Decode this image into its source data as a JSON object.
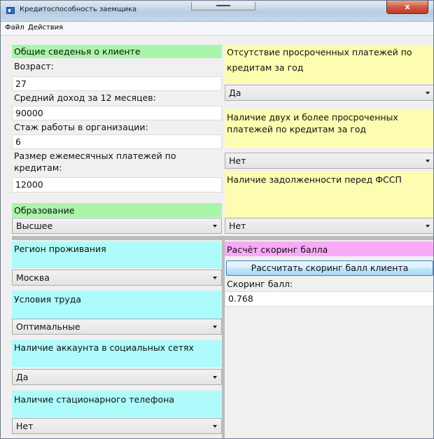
{
  "window": {
    "title": "Кредитоспособность заемщика",
    "close_label": "x"
  },
  "menu": {
    "items": [
      "Файл",
      "Действия"
    ]
  },
  "client": {
    "header": "Общие сведенья о клиенте",
    "age_label": "Возраст:",
    "age_value": "27",
    "income_label": "Средний доход за 12 месяцев:",
    "income_value": "90000",
    "experience_label": "Стаж работы в организации:",
    "experience_value": "6",
    "payments_label": "Размер ежемесячных платежей по кредитам:",
    "payments_value": "12000",
    "education_label": "Образование",
    "education_value": "Высшее"
  },
  "credit_history": {
    "no_overdue_label": "Отсутствие просроченных платежей по кредитам за год",
    "no_overdue_value": "Да",
    "two_overdue_label": "Наличие двух и более просроченных платежей по кредитам за год",
    "two_overdue_value": "Нет",
    "fssp_label": "Наличие задолженности перед ФССП",
    "fssp_value": "Нет"
  },
  "social": {
    "region_label": "Регион проживания",
    "region_value": "Москва",
    "conditions_label": "Условия труда",
    "conditions_value": "Оптимальные",
    "social_label": "Наличие аккаунта в социальных сетях",
    "social_value": "Да",
    "phone_label": "Наличие стационарного телефона",
    "phone_value": "Нет"
  },
  "scoring": {
    "header": "Расчёт скоринг балла",
    "button_label": "Рассчитать скоринг балл клиента",
    "score_label": "Скоринг балл:",
    "score_value": "0.768"
  },
  "colors": {
    "green": "#a9f5a9",
    "yellow": "#fdfdb1",
    "cyan": "#aefbfb",
    "pink": "#f8aaf8"
  }
}
